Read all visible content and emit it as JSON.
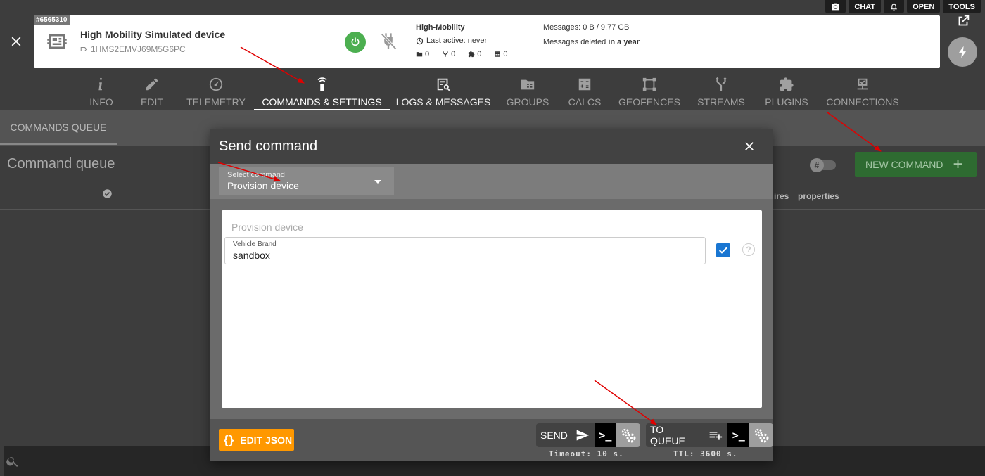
{
  "topbar": {
    "chat": "CHAT",
    "open": "OPEN",
    "tools": "TOOLS"
  },
  "device": {
    "id_badge": "#6565310",
    "name": "High Mobility Simulated device",
    "ident": "1HMS2EMVJ69M5G6PC",
    "provider": "High-Mobility",
    "last_active": "Last active: never",
    "counts": [
      "0",
      "0",
      "0",
      "0"
    ],
    "messages": "Messages: 0 B / 9.77 GB",
    "messages_deleted_prefix": "Messages deleted ",
    "messages_deleted_value": "in a year"
  },
  "tabs": [
    {
      "label": "INFO"
    },
    {
      "label": "EDIT"
    },
    {
      "label": "TELEMETRY"
    },
    {
      "label": "COMMANDS & SETTINGS"
    },
    {
      "label": "LOGS & MESSAGES"
    },
    {
      "label": "GROUPS"
    },
    {
      "label": "CALCS"
    },
    {
      "label": "GEOFENCES"
    },
    {
      "label": "STREAMS"
    },
    {
      "label": "PLUGINS"
    },
    {
      "label": "CONNECTIONS"
    }
  ],
  "active_tab": "COMMANDS & SETTINGS",
  "subtab": "COMMANDS QUEUE",
  "queue": {
    "title": "Command queue",
    "col_expires": "ires",
    "col_properties": "properties",
    "toggle_symbol": "#",
    "new_command": "NEW COMMAND"
  },
  "modal": {
    "title": "Send command",
    "select_label": "Select command",
    "select_value": "Provision device",
    "form_title": "Provision device",
    "field_label": "Vehicle Brand",
    "field_value": "sandbox",
    "help_symbol": "?",
    "edit_json": "EDIT JSON",
    "send": "SEND",
    "send_note": "Timeout: 10 s.",
    "to_queue": "TO QUEUE",
    "queue_note": "TTL: 3600 s.",
    "terminal_symbol": ">_"
  },
  "colors": {
    "background": "#3d3d3d",
    "power_green": "#4caf50",
    "new_command_green": "#2e6b31",
    "edit_json_orange": "#ff9800",
    "checkbox_blue": "#1976d2",
    "annotation_red": "#e00000"
  }
}
